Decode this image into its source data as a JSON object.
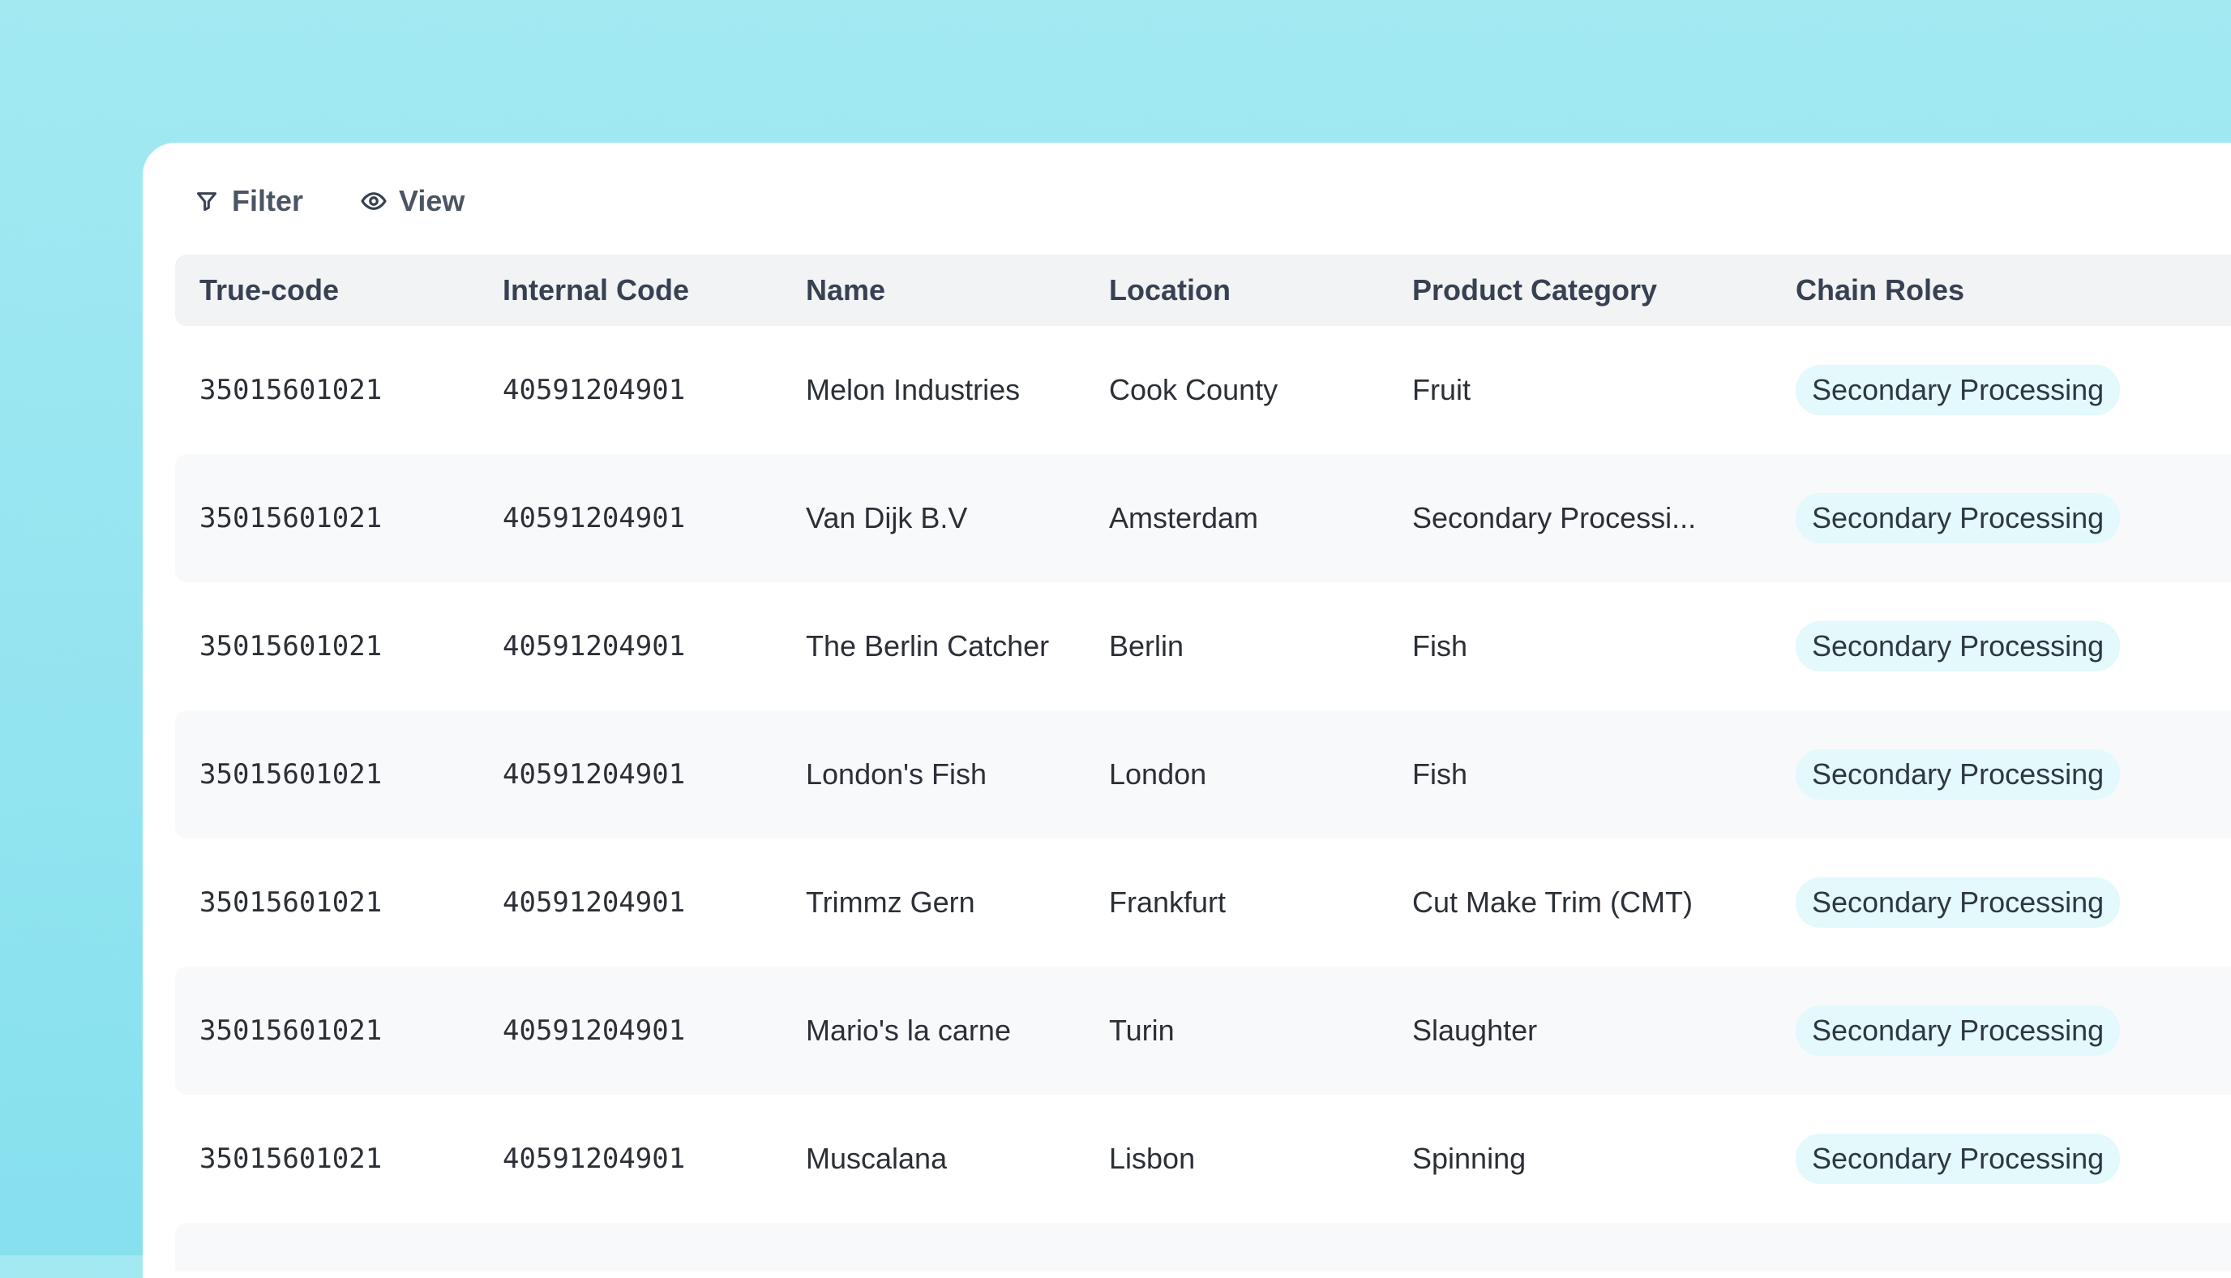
{
  "toolbar": {
    "filter": {
      "label": "Filter",
      "icon": "filter-icon"
    },
    "view": {
      "label": "View",
      "icon": "eye-icon"
    }
  },
  "table": {
    "columns": [
      "True-code",
      "Internal Code",
      "Name",
      "Location",
      "Product Category",
      "Chain Roles"
    ],
    "rows": [
      {
        "true_code": "35015601021",
        "internal_code": "40591204901",
        "name": "Melon Industries",
        "location": "Cook County",
        "category": "Fruit",
        "role": "Secondary Processing"
      },
      {
        "true_code": "35015601021",
        "internal_code": "40591204901",
        "name": "Van Dijk B.V",
        "location": "Amsterdam",
        "category": "Secondary Processi...",
        "role": "Secondary Processing"
      },
      {
        "true_code": "35015601021",
        "internal_code": "40591204901",
        "name": "The Berlin Catcher",
        "location": "Berlin",
        "category": "Fish",
        "role": "Secondary Processing"
      },
      {
        "true_code": "35015601021",
        "internal_code": "40591204901",
        "name": "London's Fish",
        "location": "London",
        "category": "Fish",
        "role": "Secondary Processing"
      },
      {
        "true_code": "35015601021",
        "internal_code": "40591204901",
        "name": "Trimmz Gern",
        "location": "Frankfurt",
        "category": "Cut Make Trim (CMT)",
        "role": "Secondary Processing"
      },
      {
        "true_code": "35015601021",
        "internal_code": "40591204901",
        "name": "Mario's la carne",
        "location": "Turin",
        "category": "Slaughter",
        "role": "Secondary Processing"
      },
      {
        "true_code": "35015601021",
        "internal_code": "40591204901",
        "name": "Muscalana",
        "location": "Lisbon",
        "category": "Spinning",
        "role": "Secondary Processing"
      }
    ]
  },
  "colors": {
    "background": "#a2e9f2",
    "panel": "#ffffff",
    "header_row": "#f1f3f5",
    "alt_row": "#f8f9fb",
    "badge": "#e3f9fc"
  }
}
